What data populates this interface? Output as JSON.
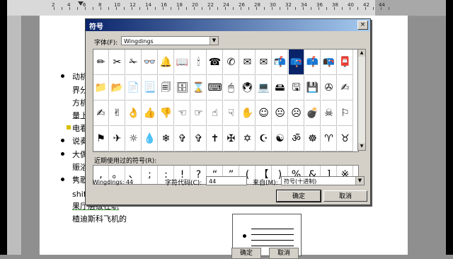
{
  "ruler": {
    "numbers": [
      "2",
      "4",
      "6",
      "8",
      "10",
      "12",
      "14",
      "16",
      "18",
      "20",
      "22",
      "24",
      "26",
      "28",
      "30",
      "32",
      "34",
      "36",
      "38",
      "40",
      "42",
      "44"
    ]
  },
  "document": {
    "lines": [
      {
        "text": "动机",
        "bullet": true
      },
      {
        "text": "界分",
        "bullet": false
      },
      {
        "text": "方机",
        "bullet": false
      },
      {
        "text": "量上",
        "bullet": false
      },
      {
        "text": "电看",
        "bullet": false,
        "mark": true
      },
      {
        "text": "说奏",
        "bullet": true
      },
      {
        "text": "大偶",
        "bullet": true
      },
      {
        "text": "赈浴",
        "bullet": false
      },
      {
        "text": "隽歌",
        "bullet": true
      },
      {
        "text": "shift+ctrl 进行演示",
        "bullet": false
      },
      {
        "text": "果厅层级在职",
        "bullet": false,
        "underline": true
      },
      {
        "text": "楂迪斯科飞机的",
        "bullet": false
      }
    ],
    "bottom_buttons": [
      "确定",
      "取消"
    ]
  },
  "dialog": {
    "title": "符号",
    "close_label": "×",
    "font_label": "字体(F):",
    "font_value": "Wingdings",
    "symbols": [
      [
        "✏",
        "✂",
        "✁",
        "👓",
        "🔔",
        "📖",
        "🕯",
        "☎",
        "✆",
        "✉",
        "✉",
        "📬",
        "📪",
        "📫",
        "📭",
        "📮"
      ],
      [
        "📁",
        "📂",
        "📄",
        "📃",
        "🗐",
        "🗄",
        "⌛",
        "⌨",
        "🖱",
        "🖲",
        "💻",
        "🖴",
        "🖫",
        "💾",
        "✇",
        "✍"
      ],
      [
        "✍",
        "✌",
        "👌",
        "👍",
        "👎",
        "☜",
        "☞",
        "☝",
        "☟",
        "✋",
        "☺",
        "😐",
        "☹",
        "💣",
        "☠",
        "⚐"
      ],
      [
        "⚑",
        "✈",
        "☼",
        "💧",
        "❄",
        "✞",
        "✞",
        "✝",
        "✠",
        "✡",
        "☪",
        "☯",
        "ॐ",
        "☸",
        "♈",
        "♉"
      ]
    ],
    "selected_symbol_index": [
      0,
      12
    ],
    "recent_label": "近期使用过的符号(R):",
    "recent_symbols": [
      ",",
      "。",
      "、",
      ";",
      ":",
      "!",
      "?",
      "“",
      "”",
      "(",
      "【",
      ")",
      "%",
      "&",
      "]",
      "※"
    ],
    "info_font": "Wingdings: 44",
    "char_code_label": "字符代码(C):",
    "char_code_value": "44",
    "from_label": "来自(M):",
    "from_value": "符号(十进制)",
    "ok_label": "确定",
    "cancel_label": "取消"
  }
}
